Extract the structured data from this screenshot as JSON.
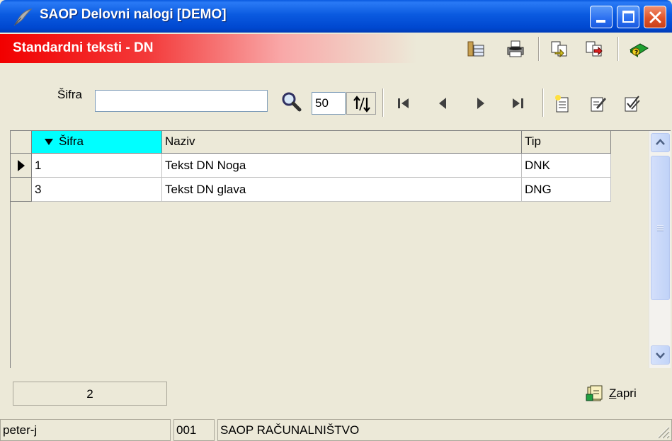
{
  "window": {
    "title": "SAOP Delovni nalogi [DEMO]"
  },
  "subheader": {
    "title": "Standardni teksti - DN"
  },
  "search": {
    "label": "Šifra",
    "value": "",
    "count": "50"
  },
  "grid": {
    "columns": [
      {
        "label": "Šifra",
        "sorted": true
      },
      {
        "label": "Naziv"
      },
      {
        "label": "Tip"
      }
    ],
    "rows": [
      {
        "sifra": "1",
        "naziv": "Tekst DN Noga",
        "tip": "DNK",
        "current": true
      },
      {
        "sifra": "3",
        "naziv": "Tekst DN glava",
        "tip": "DNG",
        "current": false
      }
    ]
  },
  "footer": {
    "record_count": "2",
    "close_label": "Zapri",
    "close_accel": "Z"
  },
  "status": {
    "user": "peter-j",
    "company_code": "001",
    "company_name": "SAOP RAČUNALNIŠTVO"
  },
  "colors": {
    "titlebar": "#0a5ae0",
    "header_red": "#f20000",
    "sorted_column": "#00ffff",
    "face": "#ece9d8"
  },
  "icons": {
    "title": "quill-icon",
    "toolbar": [
      "columns-icon",
      "printer-icon",
      "copy-icon",
      "export-icon",
      "help-book-icon"
    ],
    "search": "magnifier-icon",
    "spin": "sort-updown-icon",
    "nav": [
      "first-record-icon",
      "prev-record-icon",
      "next-record-icon",
      "last-record-icon"
    ],
    "edit": [
      "new-record-icon",
      "edit-record-icon",
      "check-record-icon"
    ],
    "close": "exit-book-icon"
  }
}
